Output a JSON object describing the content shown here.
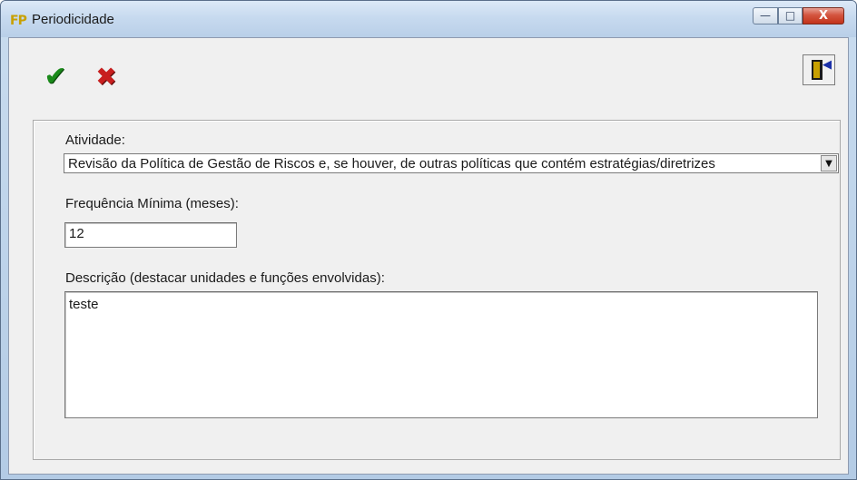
{
  "window": {
    "icon_text": "FP",
    "title": "Periodicidade",
    "controls": {
      "minimize": "—",
      "maximize": "□",
      "close": "X"
    }
  },
  "toolbar": {
    "confirm_glyph": "✔",
    "cancel_glyph": "✖",
    "exit_arrow": "◀"
  },
  "form": {
    "atividade_label": "Atividade:",
    "atividade_value": "Revisão da Política de Gestão de Riscos e, se houver, de outras políticas que contém estratégias/diretrizes",
    "dropdown_glyph": "▼",
    "frequencia_label": "Frequência Mínima (meses):",
    "frequencia_value": "12",
    "descricao_label": "Descrição (destacar unidades e funções envolvidas):",
    "descricao_value": "teste"
  },
  "colors": {
    "confirm": "#1a8a1a",
    "cancel": "#c81f1f",
    "close_button": "#c2331a"
  }
}
